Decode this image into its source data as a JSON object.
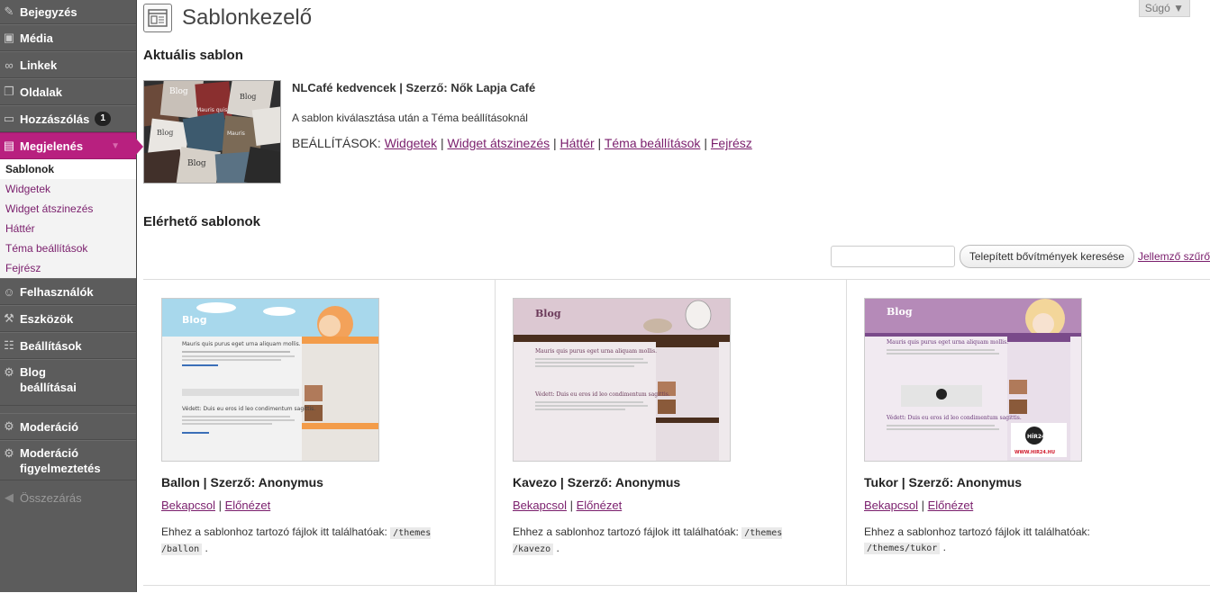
{
  "sidebar": {
    "items": [
      {
        "name": "pin-icon",
        "label": "Bejegyzés"
      },
      {
        "name": "media-icon",
        "label": "Média"
      },
      {
        "name": "link-icon",
        "label": "Linkek"
      },
      {
        "name": "pages-icon",
        "label": "Oldalak"
      },
      {
        "name": "comments-icon",
        "label": "Hozzászólás",
        "badge": "1"
      },
      {
        "name": "appearance-icon",
        "label": "Megjelenés"
      },
      {
        "name": "users-icon",
        "label": "Felhasználók"
      },
      {
        "name": "tools-icon",
        "label": "Eszközök"
      },
      {
        "name": "settings-icon",
        "label": "Beállítások"
      },
      {
        "name": "blog-settings-icon",
        "label": "Blog beállításai"
      },
      {
        "name": "moderation-icon",
        "label": "Moderáció"
      },
      {
        "name": "moderation-warning-icon",
        "label": "Moderáció figyelmeztetés"
      },
      {
        "name": "collapse-icon",
        "label": "Összezárás"
      }
    ],
    "submenu": [
      "Sablonok",
      "Widgetek",
      "Widget átszinezés",
      "Háttér",
      "Téma beállítások",
      "Fejrész"
    ]
  },
  "header": {
    "title": "Sablonkezelő",
    "help": "Súgó ▼"
  },
  "current": {
    "heading": "Aktuális sablon",
    "name": "NLCafé kedvencek | Szerző: Nők Lapja Café",
    "description": "A sablon kiválasztása után a Téma beállításoknál",
    "options_label": "BEÁLLÍTÁSOK:",
    "options": [
      "Widgetek",
      "Widget átszinezés",
      "Háttér",
      "Téma beállítások",
      "Fejrész"
    ],
    "thumb_texts": [
      "Blog",
      "Blog",
      "Mauris quis",
      "Blog",
      "Blog",
      "Mauris"
    ]
  },
  "available": {
    "heading": "Elérhető sablonok",
    "search_button": "Telepített bővítmények keresése",
    "feature_link": "Jellemző szűrő",
    "themes": [
      {
        "title": "Ballon | Szerző: Anonymus",
        "activate": "Bekapcsol",
        "preview": "Előnézet",
        "files_text": "Ehhez a sablonhoz tartozó fájlok itt találhatóak:",
        "path": "/themes /ballon",
        "thumb_blog": "Blog",
        "thumb_post1": "Mauris quis purus eget urna aliquam mollis.",
        "thumb_post2": "Védett: Duis eu eros id leo condimentum sagittis."
      },
      {
        "title": "Kavezo | Szerző: Anonymus",
        "activate": "Bekapcsol",
        "preview": "Előnézet",
        "files_text": "Ehhez a sablonhoz tartozó fájlok itt találhatóak:",
        "path": "/themes /kavezo",
        "thumb_blog": "Blog",
        "thumb_post1": "Mauris quis purus eget urna aliquam mollis.",
        "thumb_post2": "Védett: Duis eu eros id leo condimentum sagittis."
      },
      {
        "title": "Tukor | Szerző: Anonymus",
        "activate": "Bekapcsol",
        "preview": "Előnézet",
        "files_text": "Ehhez a sablonhoz tartozó fájlok itt találhatóak:",
        "path": "/themes/tukor",
        "thumb_blog": "Blog",
        "thumb_post1": "Mauris quis purus eget urna aliquam mollis.",
        "thumb_post2": "Védett: Duis eu eros id leo condimentum sagittis.",
        "thumb_ad": "HÍR24",
        "thumb_url": "WWW.HIR24.HU"
      }
    ]
  },
  "colors": {
    "accent": "#b8207f",
    "link": "#7a1e6c",
    "sidebar": "#5c5c5c"
  }
}
